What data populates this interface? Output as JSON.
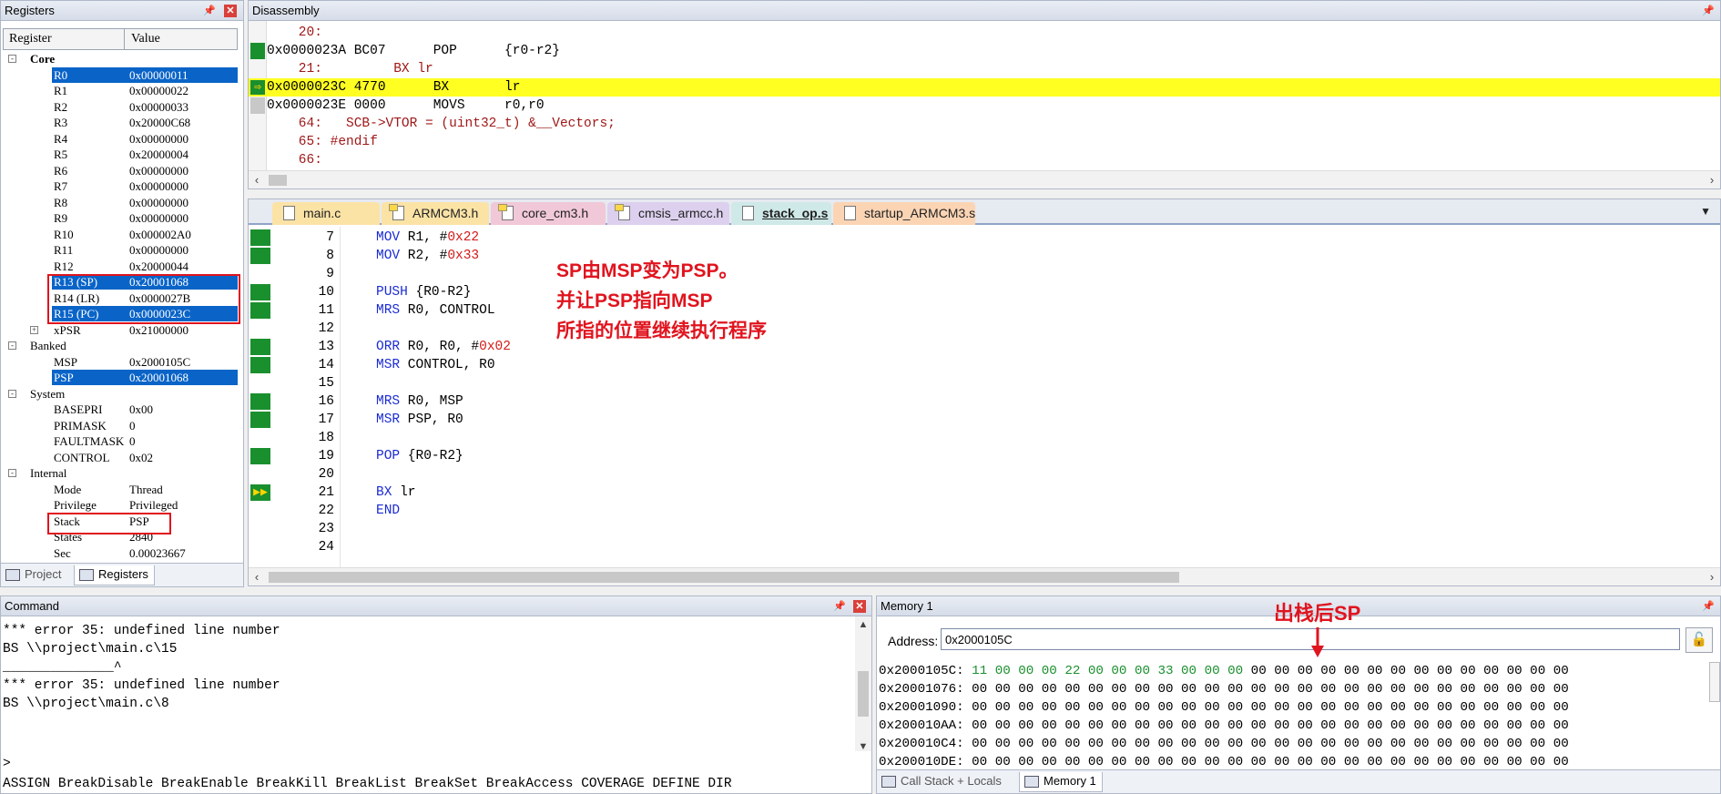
{
  "registers": {
    "title": "Registers",
    "columns": [
      "Register",
      "Value"
    ],
    "groups": [
      {
        "label": "Core",
        "rows": [
          {
            "name": "R0",
            "value": "0x00000011",
            "selected": true
          },
          {
            "name": "R1",
            "value": "0x00000022"
          },
          {
            "name": "R2",
            "value": "0x00000033"
          },
          {
            "name": "R3",
            "value": "0x20000C68"
          },
          {
            "name": "R4",
            "value": "0x00000000"
          },
          {
            "name": "R5",
            "value": "0x20000004"
          },
          {
            "name": "R6",
            "value": "0x00000000"
          },
          {
            "name": "R7",
            "value": "0x00000000"
          },
          {
            "name": "R8",
            "value": "0x00000000"
          },
          {
            "name": "R9",
            "value": "0x00000000"
          },
          {
            "name": "R10",
            "value": "0x000002A0"
          },
          {
            "name": "R11",
            "value": "0x00000000"
          },
          {
            "name": "R12",
            "value": "0x20000044"
          },
          {
            "name": "R13 (SP)",
            "value": "0x20001068",
            "selected": true
          },
          {
            "name": "R14 (LR)",
            "value": "0x0000027B"
          },
          {
            "name": "R15 (PC)",
            "value": "0x0000023C",
            "selected": true
          },
          {
            "name": "xPSR",
            "value": "0x21000000",
            "expandable": true
          }
        ]
      },
      {
        "label": "Banked",
        "rows": [
          {
            "name": "MSP",
            "value": "0x2000105C"
          },
          {
            "name": "PSP",
            "value": "0x20001068",
            "selected": true
          }
        ]
      },
      {
        "label": "System",
        "rows": [
          {
            "name": "BASEPRI",
            "value": "0x00"
          },
          {
            "name": "PRIMASK",
            "value": "0"
          },
          {
            "name": "FAULTMASK",
            "value": "0"
          },
          {
            "name": "CONTROL",
            "value": "0x02"
          }
        ]
      },
      {
        "label": "Internal",
        "rows": [
          {
            "name": "Mode",
            "value": "Thread"
          },
          {
            "name": "Privilege",
            "value": "Privileged"
          },
          {
            "name": "Stack",
            "value": "PSP"
          },
          {
            "name": "States",
            "value": "2840"
          },
          {
            "name": "Sec",
            "value": "0.00023667"
          }
        ]
      }
    ],
    "bottom_tabs": [
      "Project",
      "Registers"
    ]
  },
  "disassembly": {
    "title": "Disassembly",
    "lines": [
      {
        "text": "    20:",
        "kind": "src"
      },
      {
        "text": "0x0000023A BC07      POP      {r0-r2}",
        "kind": "asm"
      },
      {
        "text": "    21:         BX lr",
        "kind": "src"
      },
      {
        "text": "0x0000023C 4770      BX       lr",
        "kind": "asm",
        "current": true
      },
      {
        "text": "0x0000023E 0000      MOVS     r0,r0",
        "kind": "asm"
      },
      {
        "text": "    64:   SCB->VTOR = (uint32_t) &__Vectors;",
        "kind": "src"
      },
      {
        "text": "    65: #endif",
        "kind": "src"
      },
      {
        "text": "    66:",
        "kind": "src"
      }
    ]
  },
  "editor": {
    "tabs": [
      "main.c",
      "ARMCM3.h",
      "core_cm3.h",
      "cmsis_armcc.h",
      "stack_op.s",
      "startup_ARMCM3.s"
    ],
    "active_tab": "stack_op.s",
    "line_numbers": [
      "7",
      "8",
      "9",
      "10",
      "11",
      "12",
      "13",
      "14",
      "15",
      "16",
      "17",
      "18",
      "19",
      "20",
      "21",
      "22",
      "23",
      "24"
    ],
    "code": {
      "l7a": "MOV",
      "l7b": " R1, #",
      "l7c": "0x22",
      "l8a": "MOV",
      "l8b": " R2, #",
      "l8c": "0x33",
      "l10a": "PUSH",
      "l10b": " {R0-R2}",
      "l11a": "MRS",
      "l11b": " R0, CONTROL",
      "l13a": "ORR",
      "l13b": " R0, R0, #",
      "l13c": "0x02",
      "l14a": "MSR",
      "l14b": " CONTROL, R0",
      "l16a": "MRS",
      "l16b": " R0, MSP",
      "l17a": "MSR",
      "l17b": " PSP, R0",
      "l19a": "POP",
      "l19b": " {R0-R2}",
      "l21a": "BX",
      "l21b": " lr",
      "l22a": "END"
    },
    "annotation": [
      "SP由MSP变为PSP。",
      "并让PSP指向MSP",
      "所指的位置继续执行程序"
    ]
  },
  "command": {
    "title": "Command",
    "lines": [
      "*** error 35: undefined line number",
      "BS \\\\project\\main.c\\15",
      "______________^",
      "*** error 35: undefined line number",
      "BS \\\\project\\main.c\\8"
    ],
    "prompt": ">",
    "hint": "ASSIGN BreakDisable BreakEnable BreakKill BreakList BreakSet BreakAccess COVERAGE DEFINE DIR"
  },
  "memory": {
    "title": "Memory 1",
    "address_label": "Address:",
    "address_value": "0x2000105C",
    "annotation": "出栈后SP",
    "rows": [
      {
        "addr": "0x2000105C:",
        "bytes": "11 00 00 00 22 00 00 00 33 00 00 00",
        "rest": " 00 00 00 00 00 00 00 00 00 00 00 00 00 00"
      },
      {
        "addr": "0x20001076:",
        "bytes": "",
        "rest": "00 00 00 00 00 00 00 00 00 00 00 00 00 00 00 00 00 00 00 00 00 00 00 00 00 00"
      },
      {
        "addr": "0x20001090:",
        "bytes": "",
        "rest": "00 00 00 00 00 00 00 00 00 00 00 00 00 00 00 00 00 00 00 00 00 00 00 00 00 00"
      },
      {
        "addr": "0x200010AA:",
        "bytes": "",
        "rest": "00 00 00 00 00 00 00 00 00 00 00 00 00 00 00 00 00 00 00 00 00 00 00 00 00 00"
      },
      {
        "addr": "0x200010C4:",
        "bytes": "",
        "rest": "00 00 00 00 00 00 00 00 00 00 00 00 00 00 00 00 00 00 00 00 00 00 00 00 00 00"
      },
      {
        "addr": "0x200010DE:",
        "bytes": "",
        "rest": "00 00 00 00 00 00 00 00 00 00 00 00 00 00 00 00 00 00 00 00 00 00 00 00 00 00"
      }
    ],
    "bottom_tabs": [
      "Call Stack + Locals",
      "Memory 1"
    ]
  }
}
